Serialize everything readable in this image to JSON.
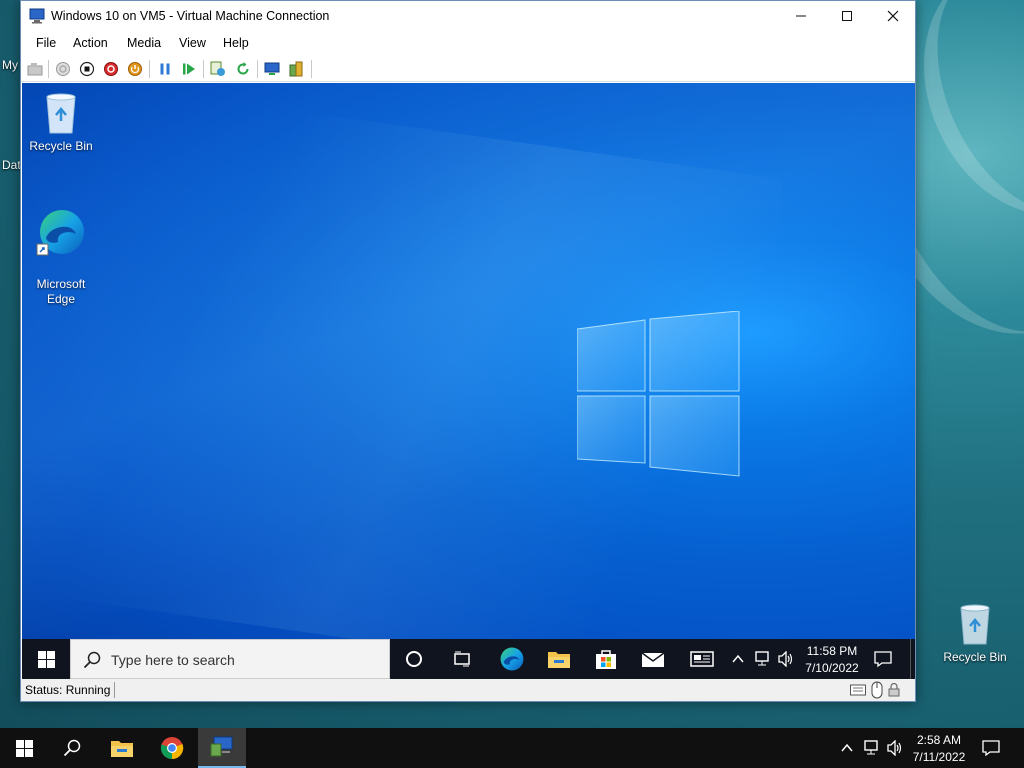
{
  "host": {
    "partial_icon_1": "My",
    "partial_icon_2": "Dat",
    "desktop_icons": [
      {
        "label": "Recycle Bin",
        "icon": "recycle-bin-icon"
      }
    ],
    "taskbar": {
      "items": [
        "start-icon",
        "search-icon",
        "file-explorer-icon",
        "chrome-icon",
        "hyper-v-connection-icon"
      ],
      "time": "2:58 AM",
      "date": "7/11/2022"
    }
  },
  "vm_window": {
    "title": "Windows 10 on VM5 - Virtual Machine Connection",
    "menu": [
      "File",
      "Action",
      "Media",
      "View",
      "Help"
    ],
    "toolbar": [
      "ctrl-alt-del-icon",
      "start-icon",
      "turn-off-icon",
      "shut-down-icon",
      "save-icon",
      "pause-icon",
      "resume-icon",
      "checkpoint-icon",
      "revert-icon",
      "enhanced-session-icon",
      "share-icon"
    ],
    "status": "Status: Running"
  },
  "guest": {
    "desktop_icons": [
      {
        "label": "Recycle Bin",
        "icon": "recycle-bin-icon"
      },
      {
        "label": "Microsoft\nEdge",
        "icon": "edge-icon"
      }
    ],
    "taskbar": {
      "search_placeholder": "Type here to search",
      "time": "11:58 PM",
      "date": "7/10/2022"
    }
  },
  "colors": {
    "guest_wallpaper": "#0a79e6",
    "host_wallpaper": "#1f6f7f",
    "taskbar": "#101010"
  }
}
